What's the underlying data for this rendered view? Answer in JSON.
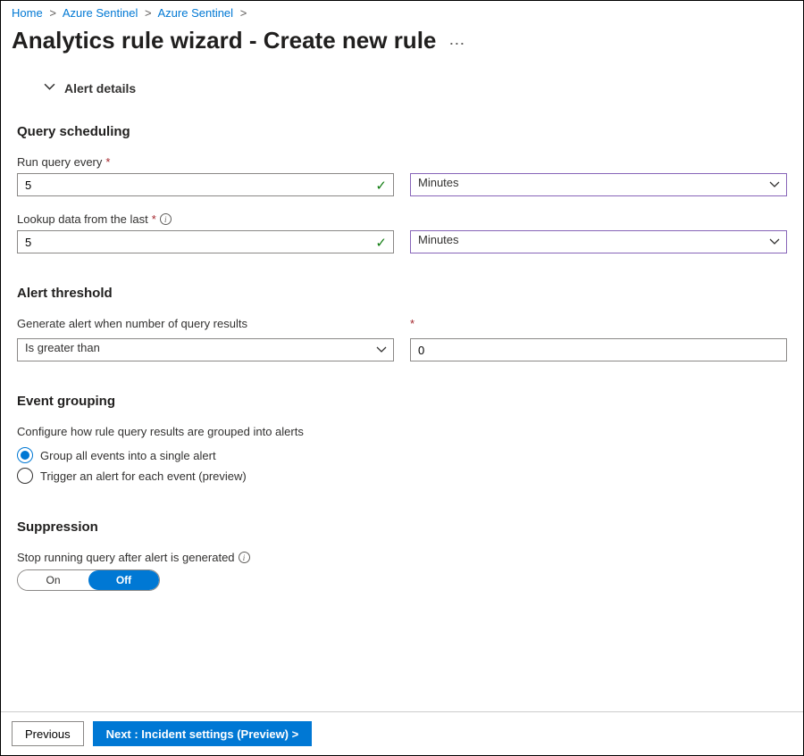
{
  "breadcrumb": {
    "items": [
      "Home",
      "Azure Sentinel",
      "Azure Sentinel"
    ]
  },
  "title": "Analytics rule wizard - Create new rule",
  "alert_details": {
    "label": "Alert details"
  },
  "scheduling": {
    "heading": "Query scheduling",
    "run_label": "Run query every",
    "run_value": "5",
    "run_unit": "Minutes",
    "lookup_label": "Lookup data from the last",
    "lookup_value": "5",
    "lookup_unit": "Minutes"
  },
  "threshold": {
    "heading": "Alert threshold",
    "label": "Generate alert when number of query results",
    "operator": "Is greater than",
    "value": "0"
  },
  "grouping": {
    "heading": "Event grouping",
    "helper": "Configure how rule query results are grouped into alerts",
    "opt1": "Group all events into a single alert",
    "opt2": "Trigger an alert for each event (preview)"
  },
  "suppression": {
    "heading": "Suppression",
    "label": "Stop running query after alert is generated",
    "on": "On",
    "off": "Off"
  },
  "footer": {
    "previous": "Previous",
    "next": "Next : Incident settings (Preview) >"
  }
}
